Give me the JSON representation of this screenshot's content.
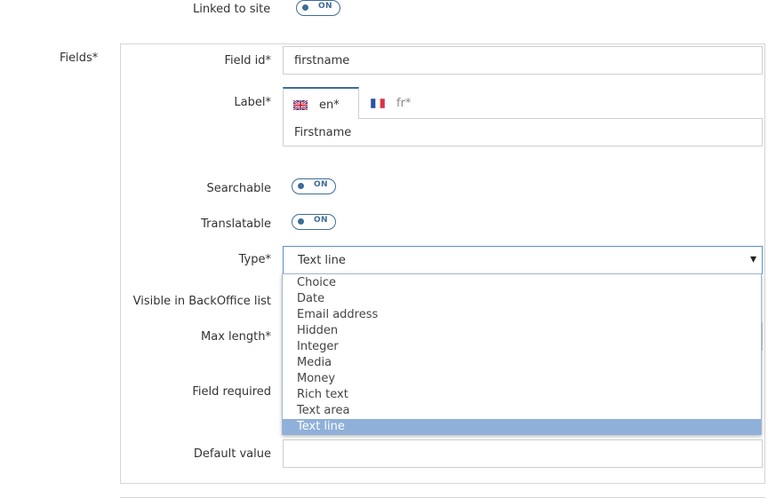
{
  "linked_to_site": {
    "label": "Linked to site",
    "toggle": "ON"
  },
  "fields_label": "Fields*",
  "field_id": {
    "label": "Field id*",
    "value": "firstname"
  },
  "label_field": {
    "label": "Label*",
    "tabs": [
      {
        "code": "en*"
      },
      {
        "code": "fr*"
      }
    ],
    "value": "Firstname"
  },
  "searchable": {
    "label": "Searchable",
    "toggle": "ON"
  },
  "translatable": {
    "label": "Translatable",
    "toggle": "ON"
  },
  "type": {
    "label": "Type*",
    "selected": "Text line",
    "arrow": "▾",
    "options": [
      "Choice",
      "Date",
      "Email address",
      "Hidden",
      "Integer",
      "Media",
      "Money",
      "Rich text",
      "Text area",
      "Text line"
    ]
  },
  "visible_in_backoffice": {
    "label": "Visible in BackOffice list"
  },
  "max_length": {
    "label": "Max length*"
  },
  "field_required": {
    "label": "Field required"
  },
  "default_value": {
    "label": "Default value",
    "value": ""
  },
  "colors": {
    "toggle": "#3d6c96",
    "highlight": "#8fb0d9",
    "border": "#cfcfcf"
  }
}
